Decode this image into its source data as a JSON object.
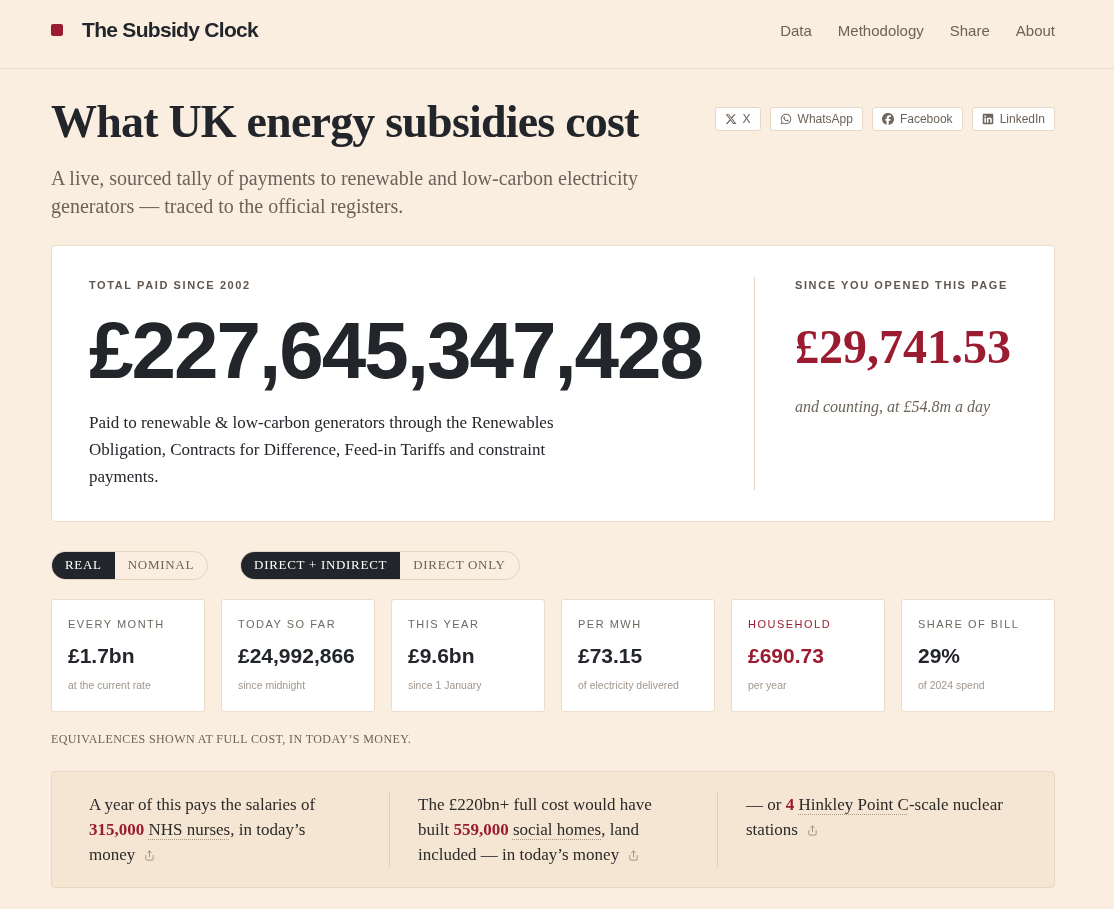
{
  "header": {
    "title": "The Subsidy Clock",
    "nav": [
      "Data",
      "Methodology",
      "Share",
      "About"
    ]
  },
  "hero": {
    "title": "What UK energy subsidies cost",
    "subtitle": "A live, sourced tally of payments to renewable and low-carbon electricity generators — traced to the official registers."
  },
  "share_buttons": [
    "X",
    "WhatsApp",
    "Facebook",
    "LinkedIn"
  ],
  "total_card": {
    "label": "TOTAL PAID SINCE 2002",
    "amount": "£227,645,347,428",
    "description": "Paid to renewable & low-carbon generators through the Renewables Obligation, Contracts for Difference, Feed-in Tariffs and constraint payments.",
    "session_label": "SINCE YOU OPENED THIS PAGE",
    "session_amount": "£29,741.53",
    "session_note": "and counting, at £54.8m a day"
  },
  "toggles": [
    {
      "options": [
        {
          "label": "REAL",
          "selected": true
        },
        {
          "label": "NOMINAL",
          "selected": false
        }
      ]
    },
    {
      "options": [
        {
          "label": "DIRECT + INDIRECT",
          "selected": true
        },
        {
          "label": "DIRECT ONLY",
          "selected": false
        }
      ]
    }
  ],
  "stats": [
    {
      "label": "EVERY MONTH",
      "value": "£1.7bn",
      "note": "at the current rate",
      "highlighted": false
    },
    {
      "label": "TODAY SO FAR",
      "value": "£24,992,866",
      "note": "since midnight",
      "highlighted": false
    },
    {
      "label": "THIS YEAR",
      "value": "£9.6bn",
      "note": "since 1 January",
      "highlighted": false
    },
    {
      "label": "PER MWH",
      "value": "£73.15",
      "note": "of electricity delivered",
      "highlighted": false
    },
    {
      "label": "HOUSEHOLD",
      "value": "£690.73",
      "note": "per year",
      "highlighted": true
    },
    {
      "label": "SHARE OF BILL",
      "value": "29%",
      "note": "of 2024 spend",
      "highlighted": false
    }
  ],
  "equivalences_note": "EQUIVALENCES SHOWN AT FULL COST, IN TODAY’S MONEY.",
  "equivalences": [
    {
      "before": "A year of this pays the salaries of",
      "figure": "315,000",
      "link": "NHS nurses",
      "after": ", in today’s money"
    },
    {
      "before": "The £220bn+ full cost would have built",
      "figure": "559,000",
      "link": "social homes",
      "after": ", land included — in today’s money"
    },
    {
      "before": "— or",
      "figure": "4",
      "link": "Hinkley Point C",
      "after": "-scale nuclear stations"
    }
  ]
}
